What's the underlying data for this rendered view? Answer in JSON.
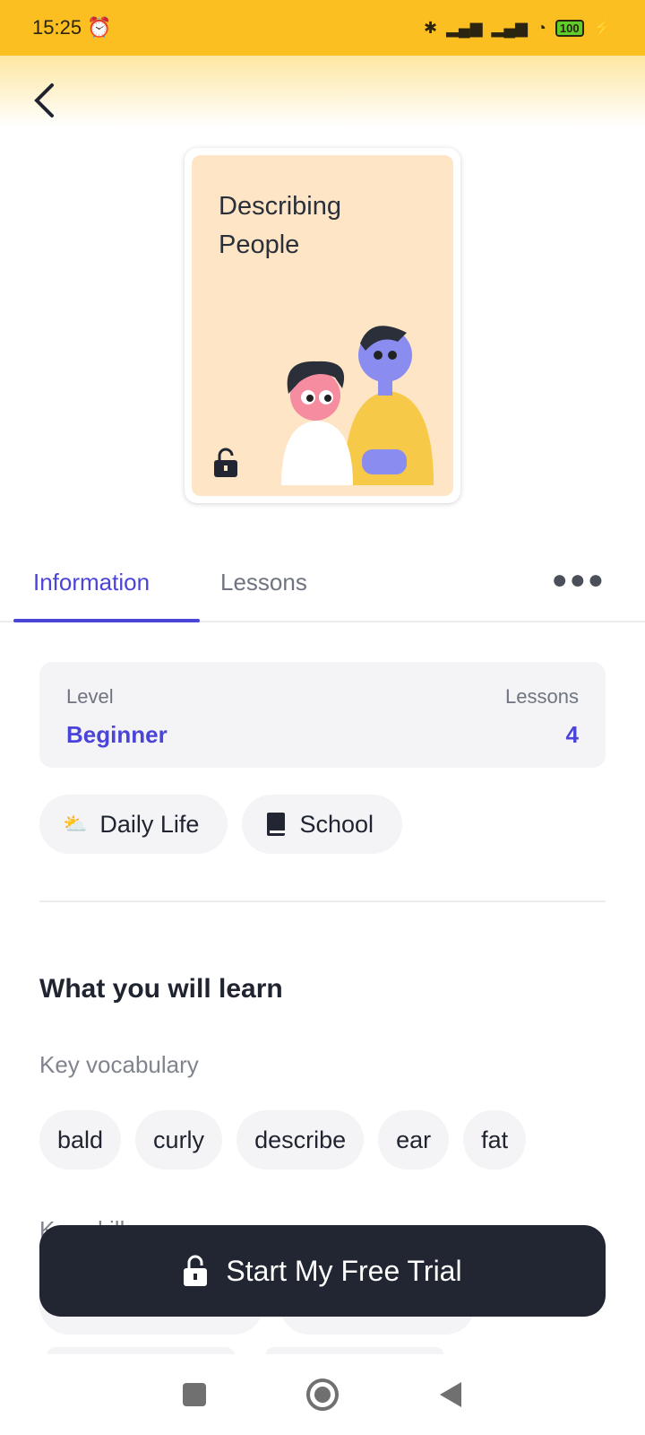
{
  "status_bar": {
    "time": "15:25",
    "battery": "100"
  },
  "course": {
    "title": "Describing\nPeople"
  },
  "tabs": [
    {
      "label": "Information"
    },
    {
      "label": "Lessons"
    }
  ],
  "info": {
    "level_label": "Level",
    "level_value": "Beginner",
    "lessons_label": "Lessons",
    "lessons_value": "4"
  },
  "categories": [
    {
      "label": "Daily Life",
      "icon": "cloud-sun-icon"
    },
    {
      "label": "School",
      "icon": "book-icon"
    }
  ],
  "learn": {
    "heading": "What you will learn",
    "vocab_label": "Key vocabulary",
    "vocab": [
      "bald",
      "curly",
      "describe",
      "ear",
      "fat"
    ],
    "skills_label": "Key skills"
  },
  "cta": {
    "label": "Start My Free Trial"
  },
  "colors": {
    "accent": "#4b44d8",
    "status_bar": "#fcbf22",
    "cta": "#222633"
  }
}
